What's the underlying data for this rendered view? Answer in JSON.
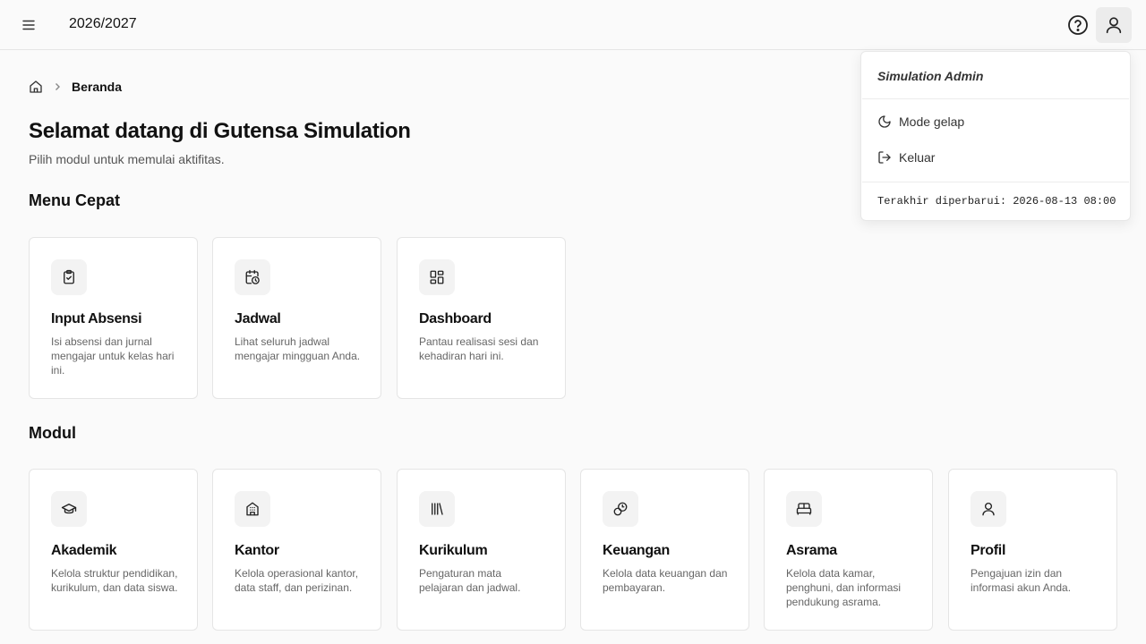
{
  "header": {
    "year": "2026/2027"
  },
  "breadcrumb": {
    "current": "Beranda"
  },
  "page": {
    "title": "Selamat datang di Gutensa Simulation",
    "subtitle": "Pilih modul untuk memulai aktifitas."
  },
  "quick_menu": {
    "title": "Menu Cepat",
    "items": [
      {
        "icon": "clipboard-check-icon",
        "title": "Input Absensi",
        "desc": "Isi absensi dan jurnal mengajar untuk kelas hari ini."
      },
      {
        "icon": "calendar-clock-icon",
        "title": "Jadwal",
        "desc": "Lihat seluruh jadwal mengajar mingguan Anda."
      },
      {
        "icon": "dashboard-icon",
        "title": "Dashboard",
        "desc": "Pantau realisasi sesi dan kehadiran hari ini."
      }
    ]
  },
  "modules": {
    "title": "Modul",
    "items": [
      {
        "icon": "graduation-cap-icon",
        "title": "Akademik",
        "desc": "Kelola struktur pendidikan, kurikulum, dan data siswa."
      },
      {
        "icon": "office-building-icon",
        "title": "Kantor",
        "desc": "Kelola operasional kantor, data staff, dan perizinan."
      },
      {
        "icon": "library-icon",
        "title": "Kurikulum",
        "desc": "Pengaturan mata pelajaran dan jadwal."
      },
      {
        "icon": "coins-icon",
        "title": "Keuangan",
        "desc": "Kelola data keuangan dan pembayaran."
      },
      {
        "icon": "bed-icon",
        "title": "Asrama",
        "desc": "Kelola data kamar, penghuni, dan informasi pendukung asrama."
      },
      {
        "icon": "user-icon",
        "title": "Profil",
        "desc": "Pengajuan izin dan informasi akun Anda."
      }
    ]
  },
  "user_menu": {
    "name": "Simulation Admin",
    "dark_mode": "Mode gelap",
    "logout": "Keluar",
    "last_updated": "Terakhir diperbarui: 2026-08-13 08:00"
  }
}
